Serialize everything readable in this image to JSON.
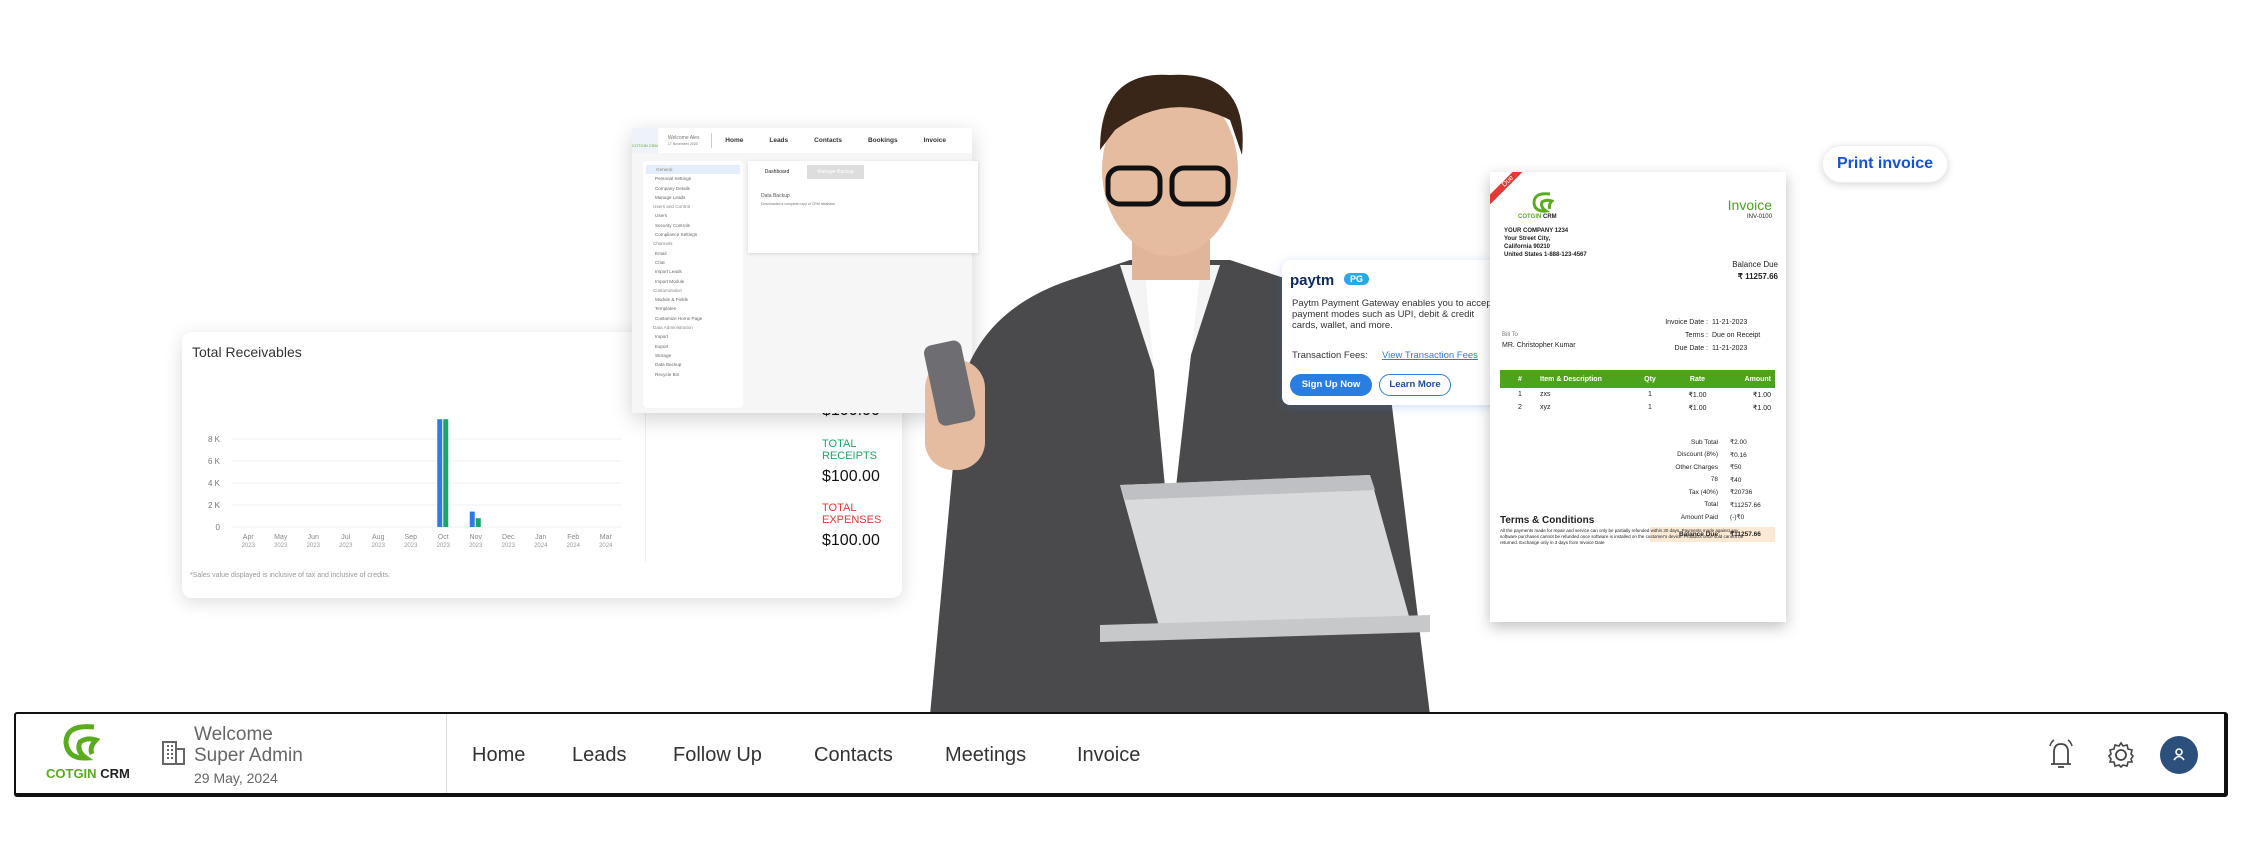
{
  "settings_preview": {
    "logo": "COTGIN CRM",
    "welcome": "Welcome Alex",
    "date": "17 November 2023",
    "nav": [
      "Home",
      "Leads",
      "Contacts",
      "Bookings",
      "Invoice"
    ],
    "sidebar": [
      {
        "label": "General",
        "section": true
      },
      {
        "label": "Personal Settings"
      },
      {
        "label": "Company Details"
      },
      {
        "label": "Manage Leads"
      },
      {
        "label": "Users and Control",
        "section": true
      },
      {
        "label": "Users"
      },
      {
        "label": "Security Controls"
      },
      {
        "label": "Compliance Settings"
      },
      {
        "label": "Channels",
        "section": true
      },
      {
        "label": "Email"
      },
      {
        "label": "Chat"
      },
      {
        "label": "Import Leads"
      },
      {
        "label": "Import Module"
      },
      {
        "label": "Customization",
        "section": true
      },
      {
        "label": "Module & Fields"
      },
      {
        "label": "Templates"
      },
      {
        "label": "Customize Home Page"
      },
      {
        "label": "Data Administration",
        "section": true
      },
      {
        "label": "Import"
      },
      {
        "label": "Export"
      },
      {
        "label": "Storage"
      },
      {
        "label": "Data Backup"
      },
      {
        "label": "Recycle Bin"
      }
    ],
    "tabs": [
      "Dashboard",
      "Manage Backup"
    ],
    "panel_title": "Data Backup",
    "panel_desc": "Downloaded a complete copy of CRM database."
  },
  "receivables": {
    "title": "Total Receivables",
    "note": "*Sales value displayed is inclusive of tax and inclusive of credits.",
    "stats": [
      {
        "label": "",
        "value": "$100.00"
      },
      {
        "label": "TOTAL RECEIPTS",
        "value": "$100.00",
        "color": "#1aa86a"
      },
      {
        "label": "TOTAL EXPENSES",
        "value": "$100.00",
        "color": "#e53935"
      }
    ]
  },
  "chart_data": {
    "type": "bar",
    "categories": [
      "Apr 2023",
      "May 2023",
      "Jun 2023",
      "Jul 2023",
      "Aug 2023",
      "Sep 2023",
      "Oct 2023",
      "Nov 2023",
      "Dec 2023",
      "Jan 2024",
      "Feb 2024",
      "Mar 2024"
    ],
    "xtick_month": [
      "Apr",
      "May",
      "Jun",
      "Jul",
      "Aug",
      "Sep",
      "Oct",
      "Nov",
      "Dec",
      "Jan",
      "Feb",
      "Mar"
    ],
    "xtick_year": [
      "2023",
      "2023",
      "2023",
      "2023",
      "2023",
      "2023",
      "2023",
      "2023",
      "2023",
      "2024",
      "2024",
      "2024"
    ],
    "yticks": [
      "0",
      "2 K",
      "4 K",
      "6 K",
      "8 K"
    ],
    "ylim": [
      0,
      10000
    ],
    "grid": true,
    "series": [
      {
        "color": "#2f7be5",
        "values": [
          0,
          0,
          0,
          0,
          0,
          0,
          9800,
          1400,
          0,
          0,
          0,
          0
        ]
      },
      {
        "color": "#17a865",
        "values": [
          0,
          0,
          0,
          0,
          0,
          0,
          9800,
          800,
          0,
          0,
          0,
          0
        ]
      }
    ]
  },
  "paytm": {
    "brand": "paytm",
    "badge": "PG",
    "desc": "Paytm Payment Gateway enables you to accept payment modes such as UPI, debit & credit cards, wallet, and more.",
    "fees_label": "Transaction Fees:",
    "fees_link": "View Transaction Fees",
    "signup": "Sign Up Now",
    "learn": "Learn More"
  },
  "invoice": {
    "ribbon": "Due",
    "logo": "COTGIN CRM",
    "title": "Invoice",
    "number": "INV-0100",
    "company": [
      "YOUR COMPANY 1234",
      "Your Street City,",
      "California 90210",
      "United States 1-888-123-4567"
    ],
    "balance_label": "Balance Due",
    "balance": "₹ 11257.66",
    "bill_to_label": "Bill To",
    "bill_to": "MR. Christopher Kumar",
    "meta": [
      {
        "k": "Invoice Date :",
        "v": "11-21-2023"
      },
      {
        "k": "Terms :",
        "v": "Due on Receipt"
      },
      {
        "k": "Due Date :",
        "v": "11-21-2023"
      }
    ],
    "columns": [
      "#",
      "Item & Description",
      "Qty",
      "Rate",
      "Amount"
    ],
    "rows": [
      [
        "1",
        "zxs",
        "1",
        "₹1.00",
        "₹1.00"
      ],
      [
        "2",
        "xyz",
        "1",
        "₹1.00",
        "₹1.00"
      ]
    ],
    "totals": [
      {
        "k": "Sub Total",
        "v": "₹2.00"
      },
      {
        "k": "Discount (8%)",
        "v": "₹0.16"
      },
      {
        "k": "Other Charges",
        "v": "₹50"
      },
      {
        "k": "78",
        "v": "₹40"
      },
      {
        "k": "Tax (40%)",
        "v": "₹20736"
      },
      {
        "k": "Total",
        "v": "₹11257.66"
      },
      {
        "k": "Amount Paid",
        "v": "(-)₹0"
      }
    ],
    "balance_row": {
      "k": "Balance Due",
      "v": "₹11257.66"
    },
    "terms_title": "Terms & Conditions",
    "terms": "All the payments made for repair and service can only be partially refunded within 30 days. Payments made against any software purchases cannot be refunded once software is installed on the customer's device. Products once sold cannot be returned. Exchange only in 3 days from Invoice Date"
  },
  "print_label": "Print invoice",
  "nav": {
    "logo": "COTGIN CRM",
    "logo_green": "COTGIN",
    "logo_dark": "CRM",
    "welcome": "Welcome Super Admin",
    "date": "29 May, 2024",
    "items": [
      "Home",
      "Leads",
      "Follow Up",
      "Contacts",
      "Meetings",
      "Invoice"
    ],
    "icons": [
      "bell-icon",
      "gear-icon",
      "user-avatar-icon"
    ],
    "brand_color": "#5aab1e",
    "avatar_color": "#2c4f7c"
  }
}
